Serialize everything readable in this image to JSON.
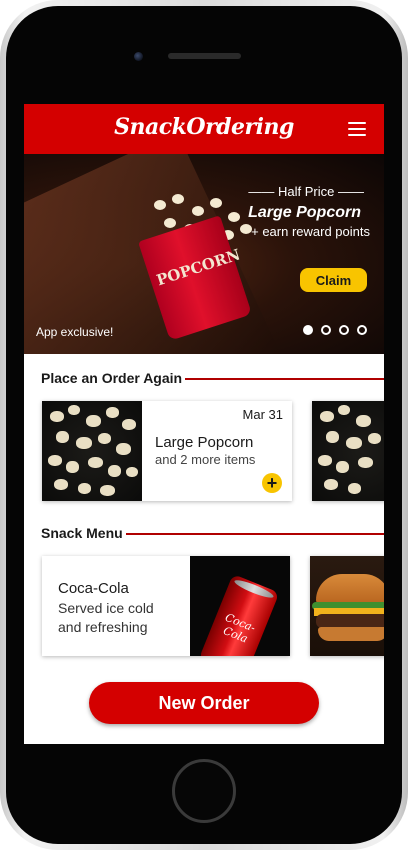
{
  "app": {
    "title": "SnackOrdering",
    "menu_icon": "hamburger-menu-icon"
  },
  "hero": {
    "subtitle": "—— Half Price ——",
    "title": "Large Popcorn",
    "note": "+ earn reward points",
    "claim_label": "Claim",
    "tag": "App exclusive!",
    "box_text": "POPCORN",
    "slides_total": 4,
    "slide_active": 1
  },
  "order_again": {
    "heading": "Place an Order Again",
    "cards": [
      {
        "date": "Mar 31",
        "item": "Large Popcorn",
        "more": "and 2 more items",
        "add_icon": "plus-icon",
        "add_label": "+"
      },
      {
        "date": "",
        "item": "",
        "more": ""
      }
    ]
  },
  "snack_menu": {
    "heading": "Snack Menu",
    "items": [
      {
        "name": "Coca-Cola",
        "description": "Served ice cold and refreshing",
        "can_label": "Coca-Cola"
      },
      {
        "name": "",
        "description": ""
      }
    ]
  },
  "actions": {
    "new_order_label": "New Order"
  },
  "colors": {
    "brand_red": "#d40000",
    "accent_yellow": "#f8c400"
  }
}
